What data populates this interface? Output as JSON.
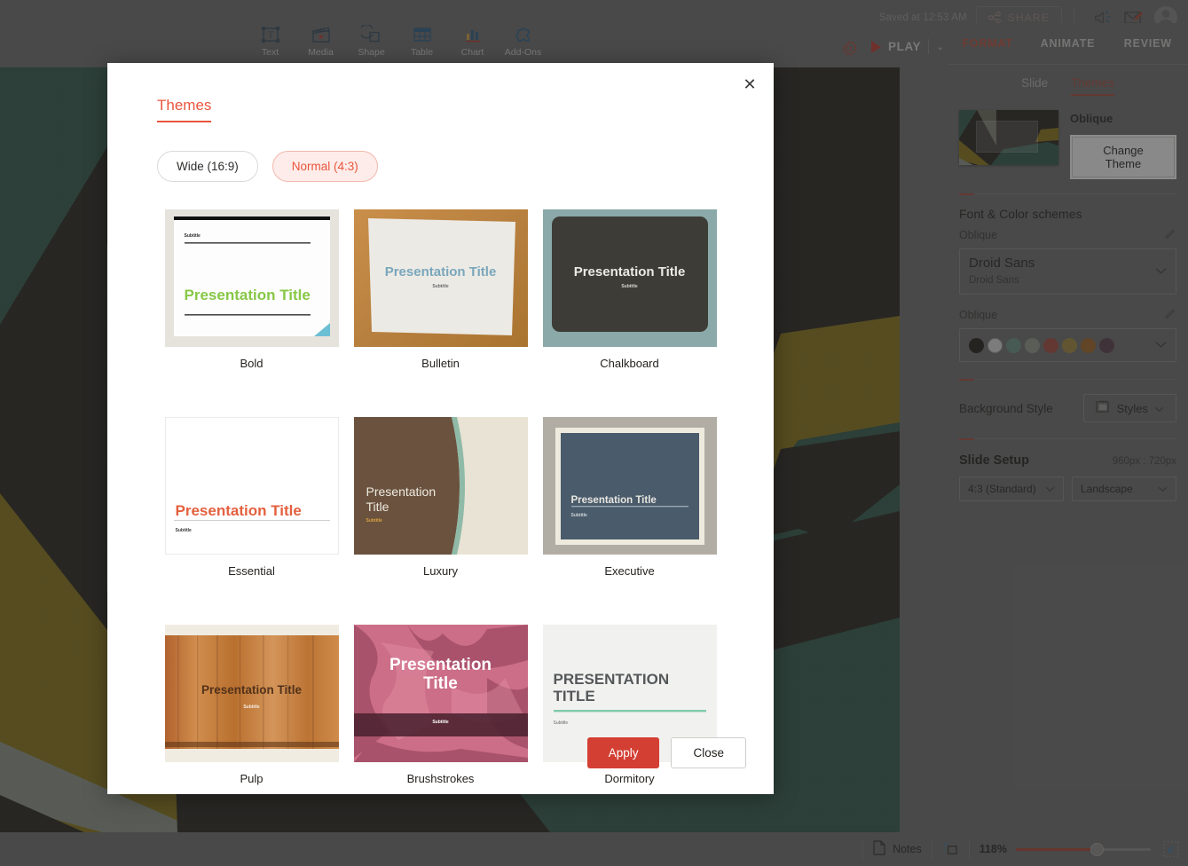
{
  "header": {
    "saved_text": "Saved at 12:53 AM",
    "share_label": "SHARE",
    "announce_icon": "megaphone-icon",
    "mail_icon": "mail-edit-icon",
    "avatar_icon": "user-avatar",
    "gear_icon": "gear-icon",
    "play_label": "PLAY",
    "play_caret": "⌄"
  },
  "toolbar": {
    "items": [
      {
        "label": "Text",
        "icon": "text-box-icon"
      },
      {
        "label": "Media",
        "icon": "media-clapperboard-icon"
      },
      {
        "label": "Shape",
        "icon": "shape-icon"
      },
      {
        "label": "Table",
        "icon": "table-icon"
      },
      {
        "label": "Chart",
        "icon": "chart-bars-icon"
      },
      {
        "label": "Add-Ons",
        "icon": "puzzle-piece-icon"
      }
    ]
  },
  "sidebar": {
    "main_tabs": [
      {
        "label": "FORMAT",
        "active": true
      },
      {
        "label": "ANIMATE",
        "active": false
      },
      {
        "label": "REVIEW",
        "active": false
      }
    ],
    "sub_tabs": [
      {
        "label": "Slide",
        "active": false
      },
      {
        "label": "Themes",
        "active": true
      }
    ],
    "current_theme": "Oblique",
    "change_theme_label": "Change Theme",
    "font_color_section_title": "Font & Color schemes",
    "font_scheme_name": "Oblique",
    "font_primary": "Droid Sans",
    "font_secondary": "Droid Sans",
    "color_scheme_name": "Oblique",
    "color_swatches": [
      "#1b1a13",
      "#dedede",
      "#6b9286",
      "#93998b",
      "#a6463a",
      "#a58a3a",
      "#a2641f",
      "#573c4a"
    ],
    "edit_icon": "pencil-edit-icon",
    "caret_icon": "chevron-down-icon",
    "background_style_label": "Background Style",
    "styles_button_label": "Styles",
    "styles_icon": "background-styles-icon",
    "slide_setup_title": "Slide Setup",
    "slide_dimensions": "960px : 720px",
    "aspect_ratio": "4:3 (Standard)",
    "orientation": "Landscape"
  },
  "statusbar": {
    "notes_label": "Notes",
    "notes_icon": "page-icon",
    "fit_icon": "fit-to-screen-icon",
    "zoom_level": "118%",
    "expand_icon": "expand-icon"
  },
  "modal": {
    "title": "Themes",
    "close_icon": "close-icon",
    "size_options": [
      {
        "label": "Wide (16:9)",
        "active": false
      },
      {
        "label": "Normal (4:3)",
        "active": true
      }
    ],
    "themes": [
      {
        "name": "Bold",
        "title_text": "Presentation Title",
        "subtitle_text": "Subtitle"
      },
      {
        "name": "Bulletin",
        "title_text": "Presentation Title",
        "subtitle_text": "Subtitle"
      },
      {
        "name": "Chalkboard",
        "title_text": "Presentation Title",
        "subtitle_text": "Subtitle"
      },
      {
        "name": "Essential",
        "title_text": "Presentation Title",
        "subtitle_text": "Subtitle"
      },
      {
        "name": "Luxury",
        "title_text": "Presentation Title",
        "subtitle_text": "Subtitle"
      },
      {
        "name": "Executive",
        "title_text": "Presentation Title",
        "subtitle_text": "Subtitle"
      },
      {
        "name": "Pulp",
        "title_text": "Presentation Title",
        "subtitle_text": "Subtitle"
      },
      {
        "name": "Brushstrokes",
        "title_text": "Presentation Title",
        "subtitle_text": "Subtitle"
      },
      {
        "name": "Dormitory",
        "title_text": "PRESENTATION TITLE",
        "subtitle_text": "Subtitle"
      }
    ],
    "apply_label": "Apply",
    "close_label": "Close"
  },
  "colors": {
    "accent_red": "#e8563d",
    "apply_red": "#d43f33",
    "chrome_gray": "#6e6e6e"
  }
}
